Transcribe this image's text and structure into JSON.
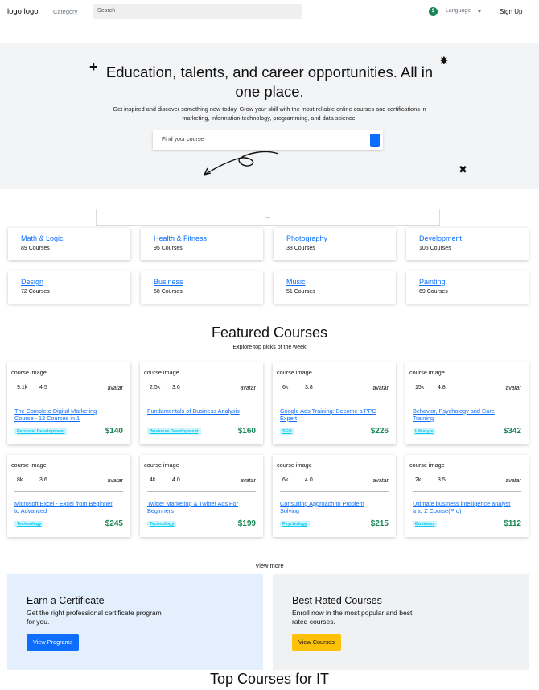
{
  "nav": {
    "logo": "logo logo",
    "category": "Category",
    "search_placeholder": "Search",
    "currency_symbol": "$",
    "language": "Language",
    "signup": "Sign Up"
  },
  "hero": {
    "title": "Education, talents, and career opportunities. All in one place.",
    "subtitle": "Get inspired and discover something new today. Grow your skill with the most reliable online courses and certifications in marketing, information technology, programming, and data science.",
    "search_placeholder": "Find your course"
  },
  "ellipsis": "...",
  "categories": [
    {
      "name": "Math & Logic",
      "count": "89 Courses"
    },
    {
      "name": "Health & Fitness",
      "count": "95 Courses"
    },
    {
      "name": "Photography",
      "count": "38 Courses"
    },
    {
      "name": "Development",
      "count": "105 Courses"
    },
    {
      "name": "Design",
      "count": "72 Courses"
    },
    {
      "name": "Business",
      "count": "68 Courses"
    },
    {
      "name": "Music",
      "count": "51 Courses"
    },
    {
      "name": "Painting",
      "count": "69 Courses"
    }
  ],
  "featured": {
    "title": "Featured Courses",
    "subtitle": "Explore top picks of the week"
  },
  "course_image_label": "course image",
  "avatar_label": "avatar",
  "courses": [
    {
      "students": "9.1k",
      "rating": "4.5",
      "title": "The Complete Digital Marketing Course - 12 Courses in 1",
      "tag": "Personal Development",
      "price": "$140"
    },
    {
      "students": "2.5k",
      "rating": "3.6",
      "title": "Fundamentals of Business Analysis",
      "tag": "Business Development",
      "price": "$160"
    },
    {
      "students": "6k",
      "rating": "3.8",
      "title": "Google Ads Training: Become a PPC Expert",
      "tag": "SEO",
      "price": "$226"
    },
    {
      "students": "15k",
      "rating": "4.8",
      "title": "Behavior, Psychology and Care Training",
      "tag": "Lifestyle",
      "price": "$342"
    },
    {
      "students": "8k",
      "rating": "3.6",
      "title": "Microsoft Excel - Excel from Beginner to Advanced",
      "tag": "Technology",
      "price": "$245"
    },
    {
      "students": "4k",
      "rating": "4.0",
      "title": "Twitter Marketing & Twitter Ads For Beginners",
      "tag": "Technology",
      "price": "$199"
    },
    {
      "students": "6k",
      "rating": "4.0",
      "title": "Consulting Approach to Problem Solving",
      "tag": "Psychology",
      "price": "$215"
    },
    {
      "students": "2k",
      "rating": "3.5",
      "title": "Ultimate business intelligence analyst a to Z Course(Pro)",
      "tag": "Business",
      "price": "$112"
    }
  ],
  "view_more": "View more",
  "promos": {
    "certificate": {
      "title": "Earn a Certificate",
      "text": "Get the right professional certificate program for you.",
      "button": "View Programs"
    },
    "rated": {
      "title": "Best Rated Courses",
      "text": "Enroll now in the most popular and best rated courses.",
      "button": "View Courses"
    }
  },
  "bottom_title": "Top Courses for IT",
  "colors": {
    "primary": "#0d6efd",
    "success": "#198754",
    "warning": "#ffc107",
    "info": "#0dcaf0"
  }
}
